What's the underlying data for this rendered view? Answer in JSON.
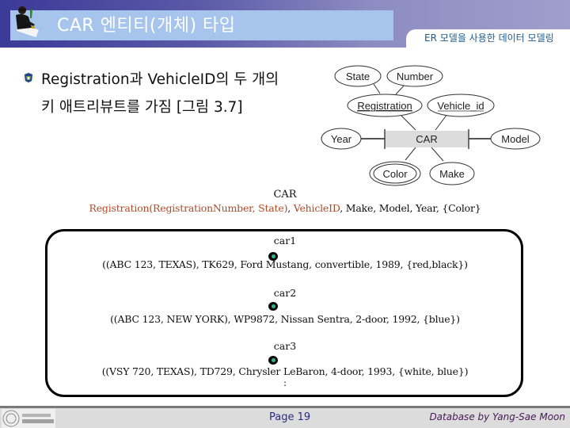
{
  "header": {
    "title": "CAR 엔티티(개체) 타입",
    "subtitle": "ER 모델을 사용한 데이터 모델링",
    "icon": "presenter-icon"
  },
  "bullet": {
    "icon": "bullet-emblem-icon",
    "line1": "Registration과 VehicleID의 두 개의",
    "line2": "키 애트리뷰트를 가짐 [그림 3.7]"
  },
  "er_diagram": {
    "entity": "CAR",
    "attributes": {
      "state": "State",
      "number": "Number",
      "registration": "Registration",
      "vehicle_id": "Vehicle_id",
      "year": "Year",
      "model": "Model",
      "color": "Color",
      "make": "Make"
    }
  },
  "schema": {
    "title": "CAR",
    "key1": "Registration(RegistrationNumber, State)",
    "sep1": ", ",
    "key2": "VehicleID",
    "rest": ", Make, Model, Year, {Color}"
  },
  "instances": [
    {
      "label": "car1",
      "value": "((ABC 123, TEXAS), TK629, Ford Mustang, convertible, 1989, {red,black})"
    },
    {
      "label": "car2",
      "value": "((ABC 123, NEW YORK), WP9872, Nissan Sentra, 2-door, 1992, {blue})"
    },
    {
      "label": "car3",
      "value": "((VSY 720, TEXAS), TD729, Chrysler LeBaron, 4-door, 1993, {white, blue})"
    }
  ],
  "instances_more": ":",
  "footer": {
    "page": "Page 19",
    "credit": "Database by Yang-Sae Moon",
    "logo": "university-logo-icon"
  }
}
